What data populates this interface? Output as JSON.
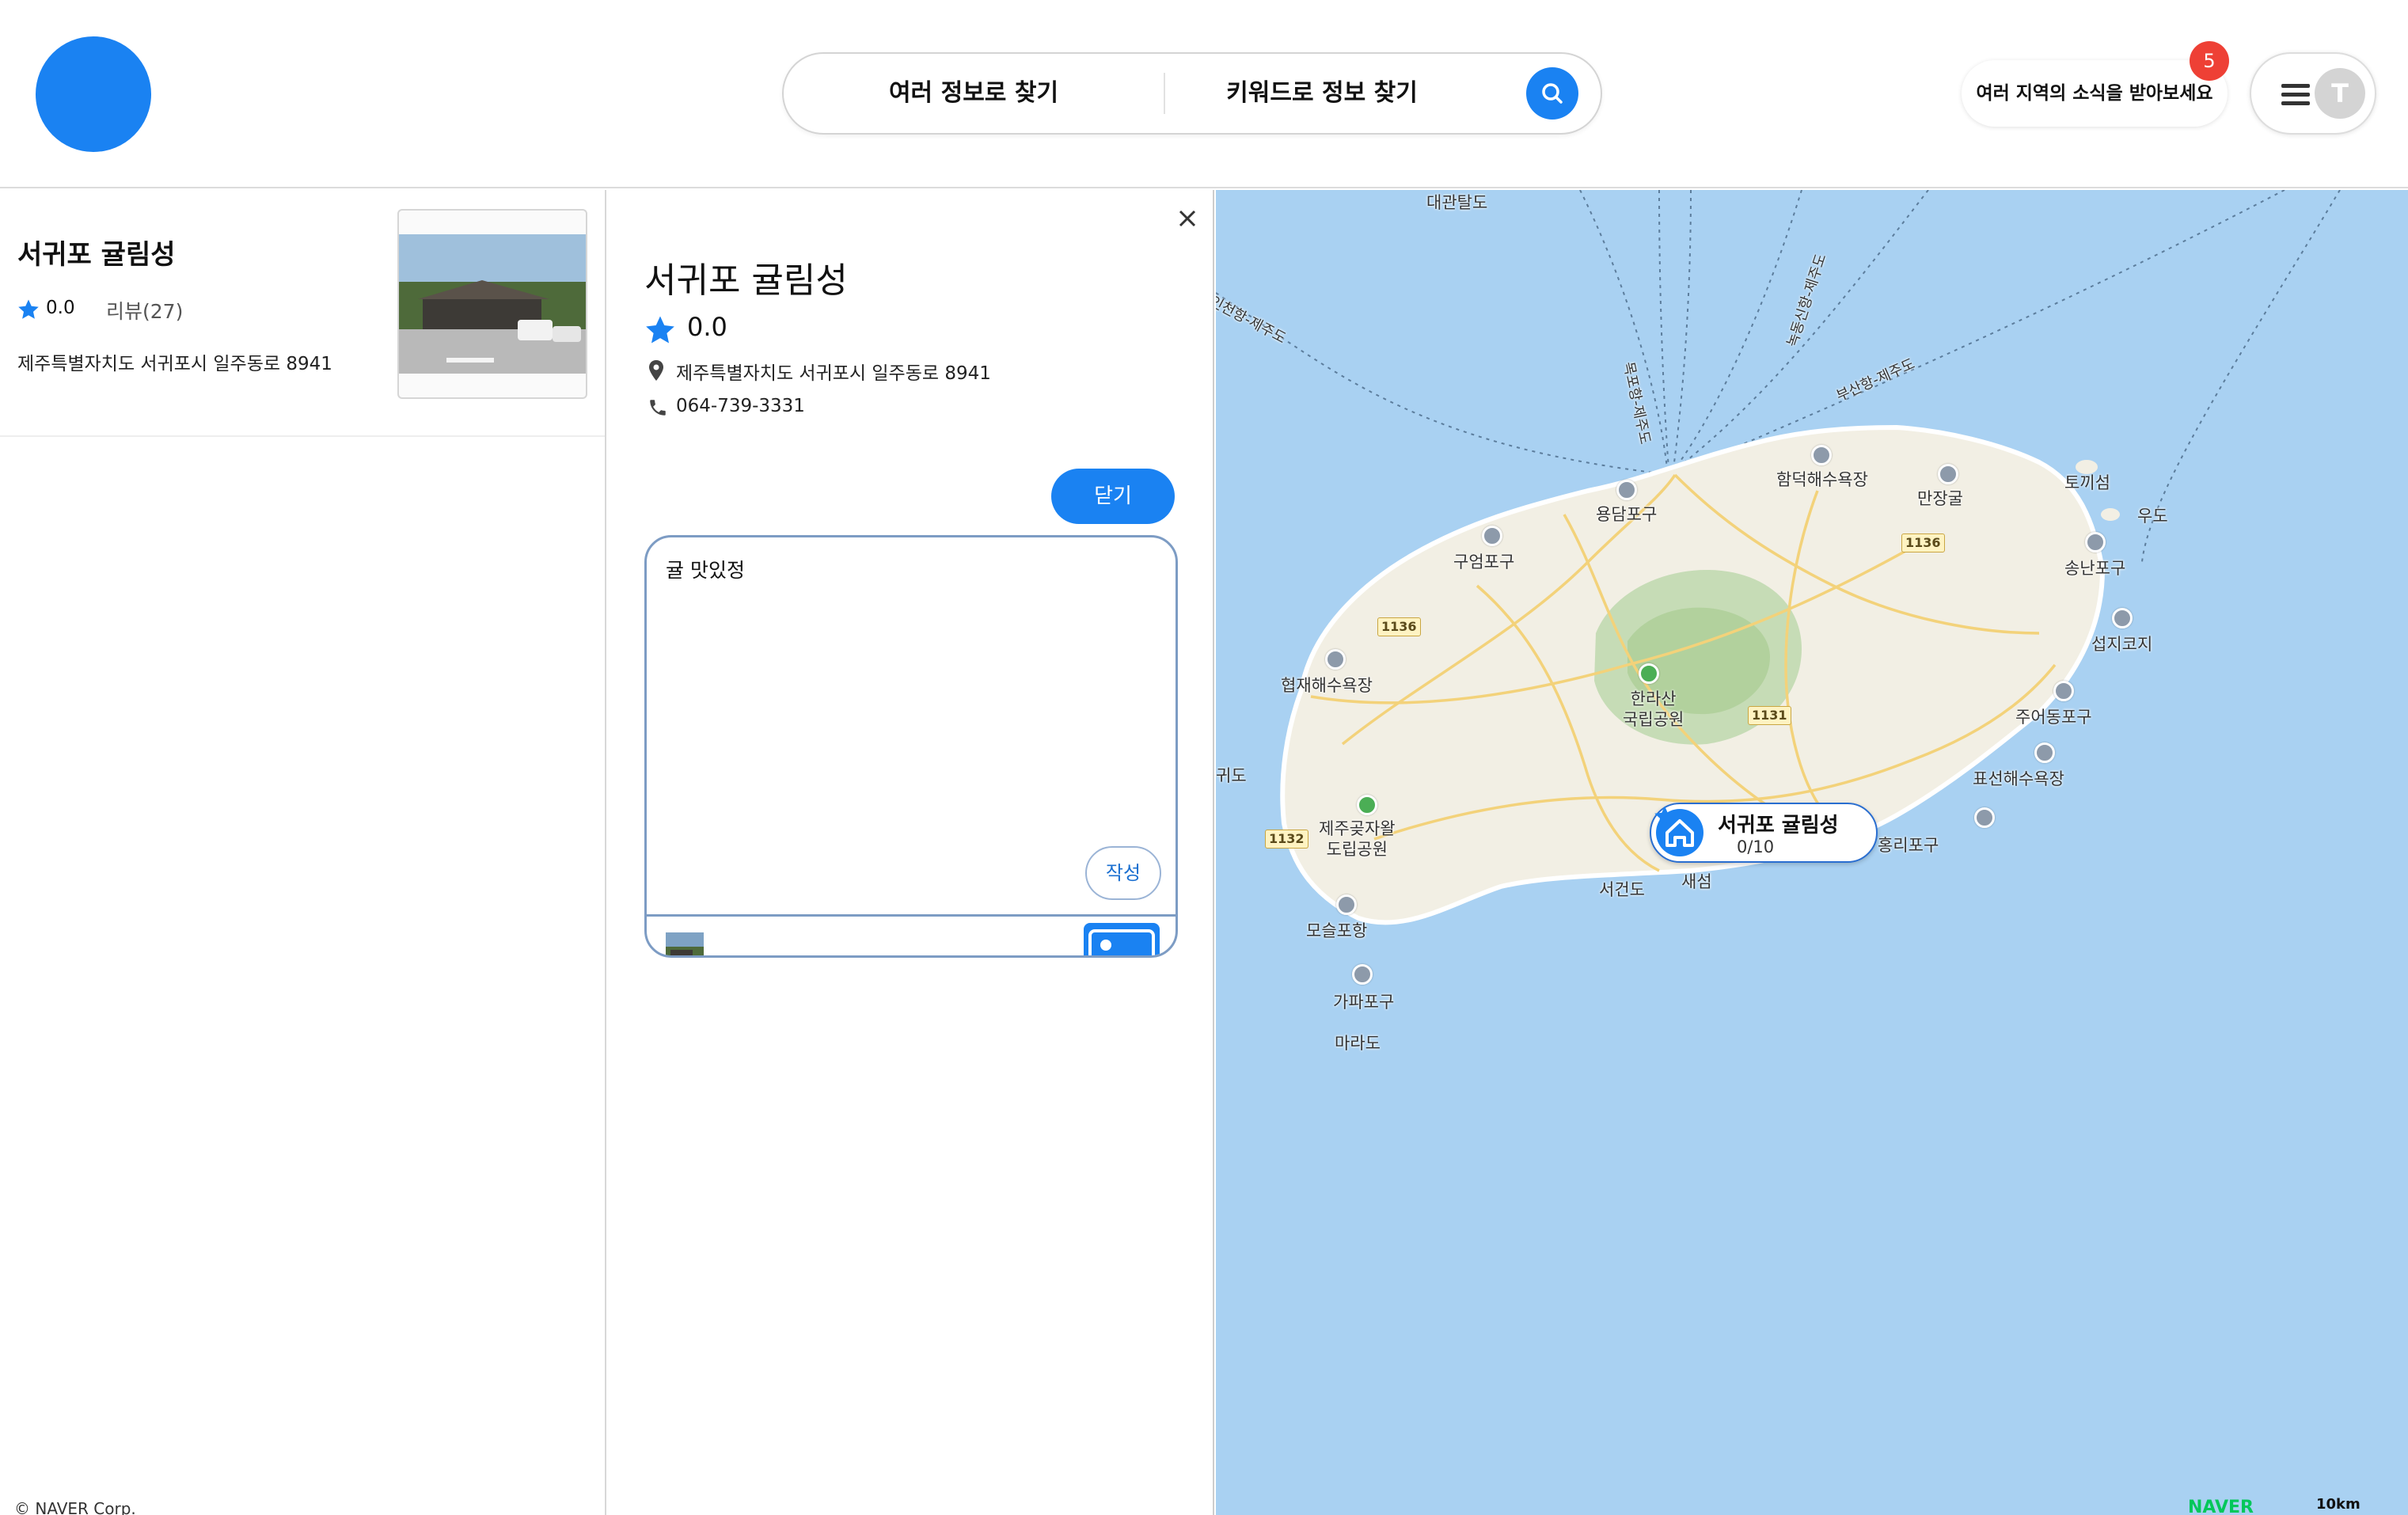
{
  "header": {
    "search_tabs": [
      "여러 정보로 찾기",
      "키워드로 정보 찾기"
    ],
    "news_button_label": "여러 지역의 소식을 받아보세요",
    "news_badge_count": "5",
    "avatar_initial": "T",
    "brand_color": "#1a82f2"
  },
  "result_list": {
    "items": [
      {
        "name": "서귀포 귤림성",
        "rating": "0.0",
        "reviews_label": "리뷰(27)",
        "address": "제주특별자치도 서귀포시 일주동로 8941"
      }
    ],
    "copyright": "© NAVER Corp."
  },
  "detail": {
    "name": "서귀포 귤림성",
    "rating": "0.0",
    "address": "제주특별자치도 서귀포시 일주동로 8941",
    "phone": "064-739-3331",
    "close_button_label": "닫기",
    "review_text": "귤 맛있정",
    "write_button_label": "작성"
  },
  "map": {
    "labels": {
      "daegwantal": "대관탈도",
      "route_left": "인천항-제주도",
      "route_mokpo": "목포항-제주도",
      "route_nokdong": "녹동신항-제주도",
      "route_busan": "부산항-제주도",
      "yongdam": "용담포구",
      "hamdeok": "함덕해수욕장",
      "manjang": "만장굴",
      "tokki": "토끼섬",
      "udo": "우도",
      "gueom": "구엄포구",
      "songnan": "송난포구",
      "seopji": "섭지코지",
      "hyeopjae": "협재해수욕장",
      "hallasan": "한라산\n국립공원",
      "jueo": "주어동포구",
      "pyoseon": "표선해수욕장",
      "gwido": "귀도",
      "jeju_forest": "제주곶자왈\n도립공원",
      "honglee": "홍리포구",
      "seogeondo": "서건도",
      "saeseom": "새섬",
      "moseul": "모슬포항",
      "gapa": "가파포구",
      "mara": "마라도"
    },
    "road_numbers": [
      "1136",
      "1136",
      "1131",
      "1132"
    ],
    "marker": {
      "name": "서귀포 귤림성",
      "count": "0/10"
    },
    "brand": "NAVER",
    "scale": "10km"
  }
}
